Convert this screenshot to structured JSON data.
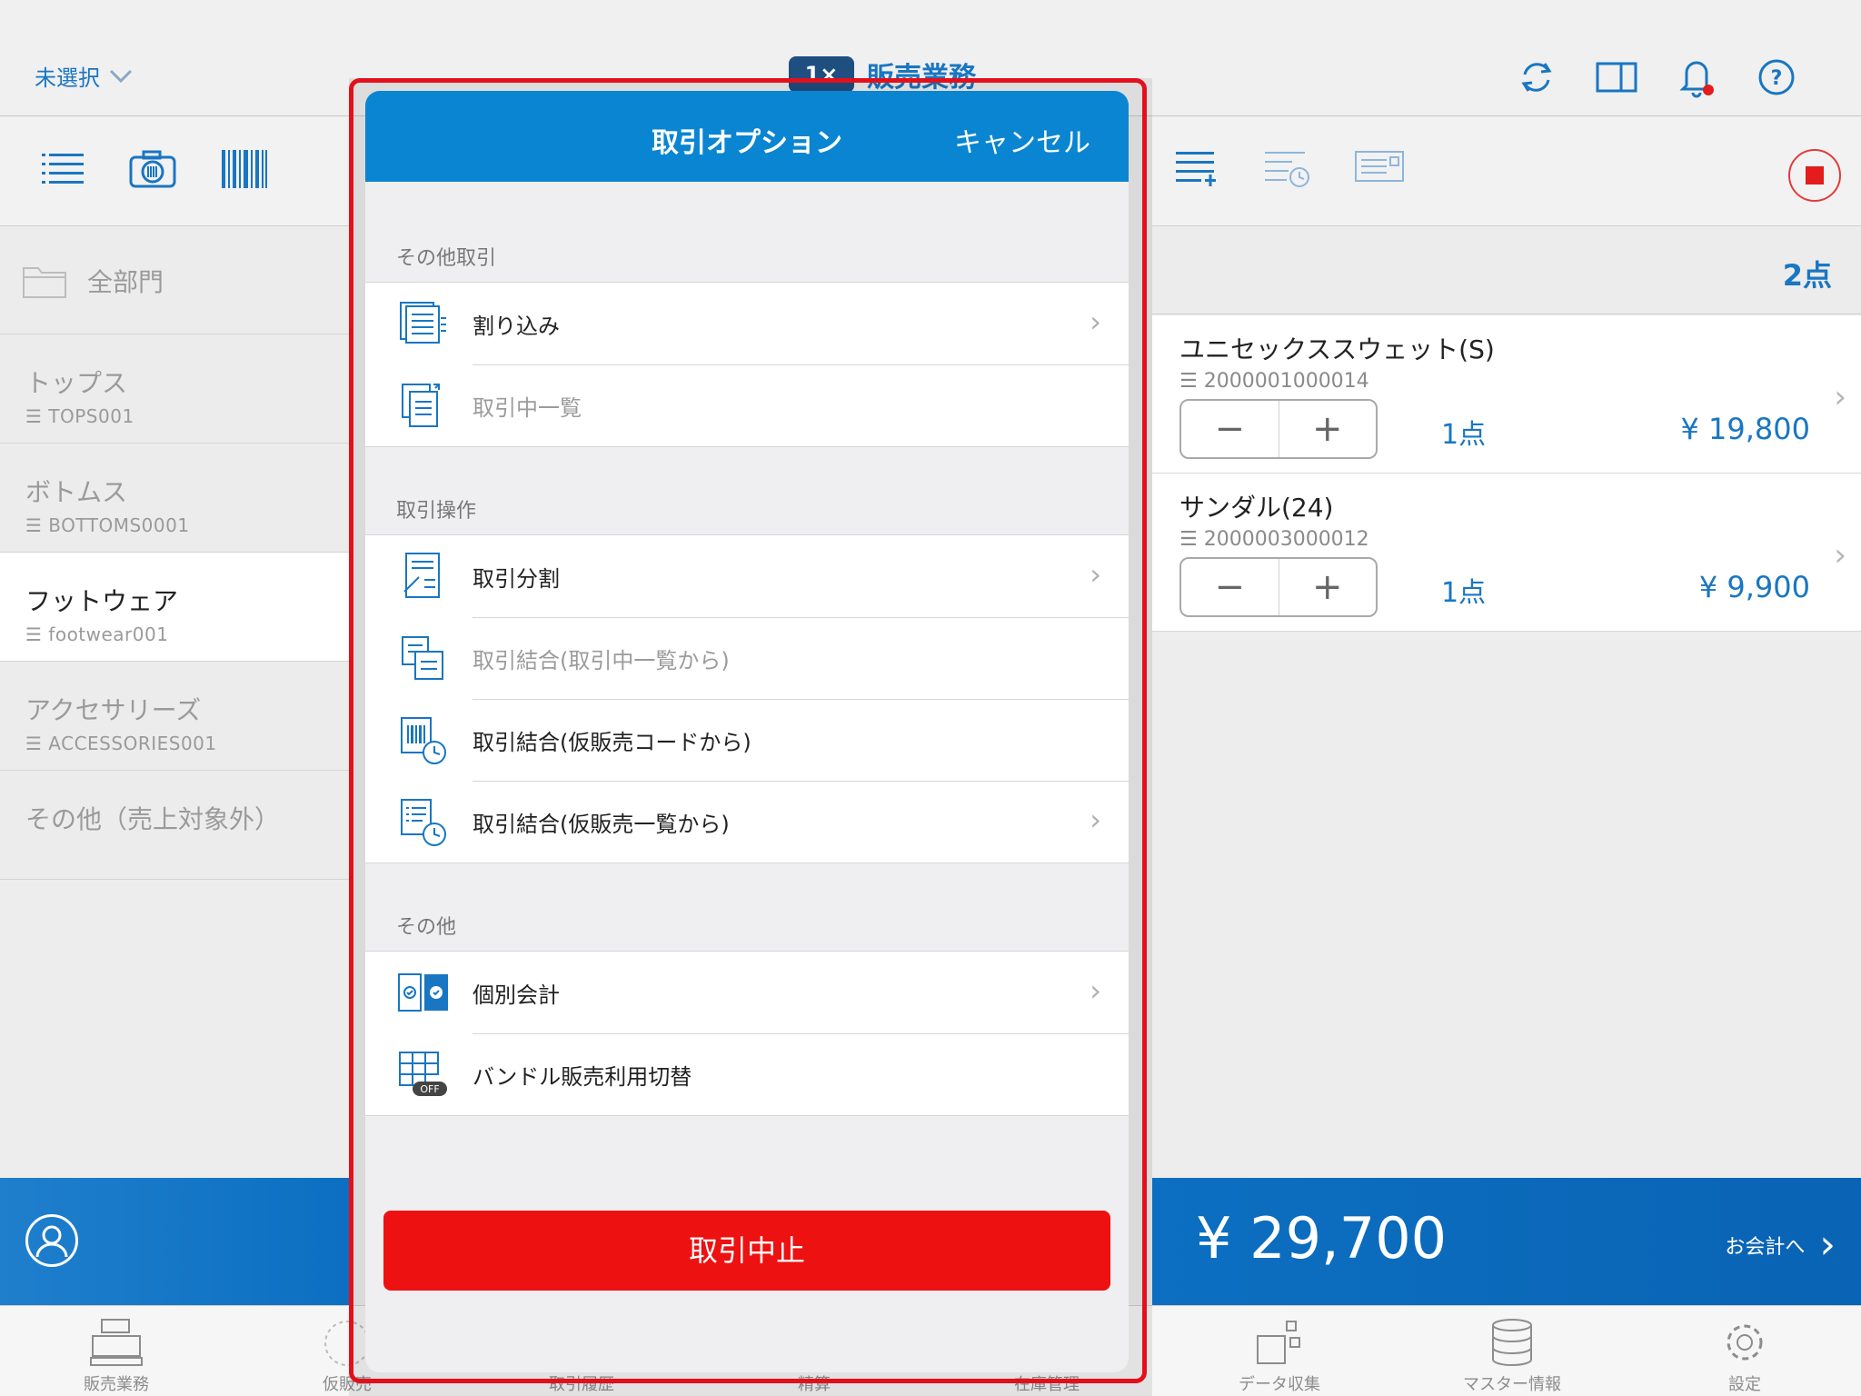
{
  "header": {
    "store_select": "未選択",
    "app_title": "販売業務",
    "logo_text": "1×"
  },
  "departments": [
    {
      "name": "全部門"
    },
    {
      "name": "トップス",
      "code": "☰ TOPS001"
    },
    {
      "name": "ボトムス",
      "code": "☰ BOTTOMS0001"
    },
    {
      "name": "フットウェア",
      "code": "☰ footwear001"
    },
    {
      "name": "アクセサリーズ",
      "code": "☰ ACCESSORIES001"
    },
    {
      "name": "その他（売上対象外）"
    }
  ],
  "cart": {
    "count_label": "2点",
    "items": [
      {
        "name": "ユニセックススウェット(S)",
        "code": "☰ 2000001000014",
        "qty": "1点",
        "price": "¥ 19,800"
      },
      {
        "name": "サンダル(24)",
        "code": "☰ 2000003000012",
        "qty": "1点",
        "price": "¥ 9,900"
      }
    ],
    "minus": "−",
    "plus": "+",
    "total": "¥ 29,700",
    "checkout_label": "お会計へ"
  },
  "modal": {
    "title": "取引オプション",
    "cancel": "キャンセル",
    "sections": [
      {
        "label": "その他取引",
        "items": [
          "割り込み",
          "取引中一覧"
        ]
      },
      {
        "label": "取引操作",
        "items": [
          "取引分割",
          "取引結合(取引中一覧から)",
          "取引結合(仮販売コードから)",
          "取引結合(仮販売一覧から)"
        ]
      },
      {
        "label": "その他",
        "items": [
          "個別会計",
          "バンドル販売利用切替"
        ]
      }
    ],
    "off_badge": "OFF",
    "abort_button": "取引中止"
  },
  "tabs": [
    "販売業務",
    "仮販売",
    "取引履歴",
    "精算",
    "在庫管理",
    "データ収集",
    "マスター情報",
    "設定"
  ],
  "colors": {
    "accent": "#1976c2",
    "header_blue": "#0a85d1",
    "danger": "#ee1111",
    "highlight": "#e3101c"
  }
}
